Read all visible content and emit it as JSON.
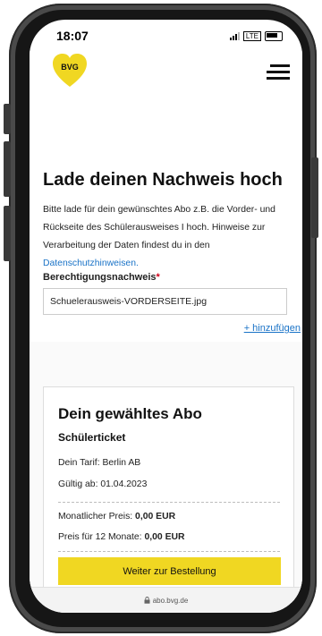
{
  "status_bar": {
    "time": "18:07",
    "network": "LTE"
  },
  "header": {
    "logo_text": "BVG",
    "brand_color": "#f0d722"
  },
  "upload": {
    "title": "Lade deinen Nachweis hoch",
    "description_text": "Bitte lade für dein gewünschtes Abo z.B. die Vorder- und Rückseite des Schülerausweises I hoch. Hinweise zur Verarbeitung der Daten findest du in den ",
    "privacy_link": "Datenschutzhinweisen.",
    "field_label": "Berechtigungsnachweis",
    "required_marker": "*",
    "file_name": "Schuelerausweis-VORDERSEITE.jpg",
    "add_link": "+ hinzufügen"
  },
  "abo": {
    "title": "Dein gewähltes Abo",
    "subtitle": "Schülerticket",
    "tariff": "Dein Tarif: Berlin AB",
    "valid_from": "Gültig ab: 01.04.2023",
    "monthly_label": "Monatlicher Preis: ",
    "monthly_value": "0,00 EUR",
    "yearly_label": "Preis für 12 Monate: ",
    "yearly_value": "0,00 EUR",
    "cta": "Weiter zur Bestellung"
  },
  "url_bar": {
    "url": "abo.bvg.de"
  },
  "icons": {
    "menu": "hamburger-menu-icon",
    "cookie": "cookie-icon",
    "lock": "lock-icon"
  },
  "colors": {
    "link": "#1a73c7",
    "required": "#d0021b",
    "cta_background": "#f0d722"
  }
}
